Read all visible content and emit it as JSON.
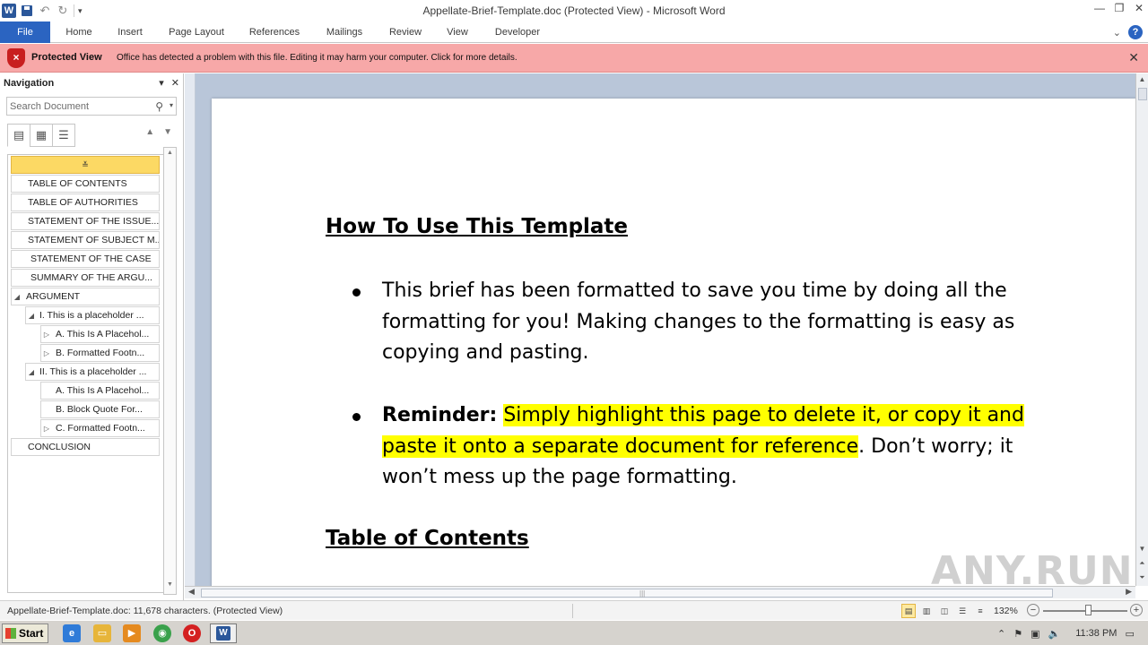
{
  "window": {
    "title": "Appellate-Brief-Template.doc (Protected View)  -  Microsoft Word",
    "app_icon_letter": "W"
  },
  "ribbon": {
    "tabs": [
      "File",
      "Home",
      "Insert",
      "Page Layout",
      "References",
      "Mailings",
      "Review",
      "View",
      "Developer"
    ],
    "help_label": "?"
  },
  "protected_view": {
    "title": "Protected View",
    "message": "Office has detected a problem with this file. Editing it may harm your computer. Click for more details.",
    "icon_glyph": "×"
  },
  "navigation": {
    "title": "Navigation",
    "search_placeholder": "Search Document",
    "headings": [
      {
        "label": "TABLE OF CONTENTS",
        "level": 1,
        "caret": ""
      },
      {
        "label": "TABLE OF AUTHORITIES",
        "level": 1,
        "caret": ""
      },
      {
        "label": "STATEMENT OF THE ISSUE...",
        "level": 1,
        "caret": ""
      },
      {
        "label": "STATEMENT OF SUBJECT M...",
        "level": 1,
        "caret": ""
      },
      {
        "label": "STATEMENT OF THE CASE",
        "level": 1,
        "caret": ""
      },
      {
        "label": "SUMMARY OF THE ARGU...",
        "level": 1,
        "caret": ""
      },
      {
        "label": "ARGUMENT",
        "level": 1,
        "caret": "◢"
      },
      {
        "label": "I. This is a placeholder ...",
        "level": 2,
        "caret": "◢"
      },
      {
        "label": "A. This Is A Placehol...",
        "level": 3,
        "caret": "▷"
      },
      {
        "label": "B. Formatted Footn...",
        "level": 3,
        "caret": "▷"
      },
      {
        "label": "II. This is a placeholder ...",
        "level": 2,
        "caret": "◢"
      },
      {
        "label": "A. This Is A Placehol...",
        "level": 3,
        "caret": ""
      },
      {
        "label": "B. Block Quote For...",
        "level": 3,
        "caret": ""
      },
      {
        "label": "C. Formatted Footn...",
        "level": 3,
        "caret": "▷"
      },
      {
        "label": "CONCLUSION",
        "level": 1,
        "caret": ""
      }
    ]
  },
  "document": {
    "heading1": "How To Use This Template",
    "bullet1": "This brief has been formatted to save you time by doing all the formatting for you! Making changes to the formatting is easy as copying and pasting.",
    "bullet2_bold": "Reminder:",
    "bullet2_highlight": "Simply highlight this page to delete it, or copy it and paste it onto a separate document for reference",
    "bullet2_rest": ". Don’t worry; it won’t mess up the page formatting.",
    "heading2": "Table of Contents",
    "highlight_color": "#ffff00"
  },
  "statusbar": {
    "info": "Appellate-Brief-Template.doc: 11,678 characters.  (Protected View)",
    "zoom": "132%"
  },
  "taskbar": {
    "start_label": "Start",
    "clock": "11:38 PM"
  },
  "watermark": "ANY.RUN"
}
